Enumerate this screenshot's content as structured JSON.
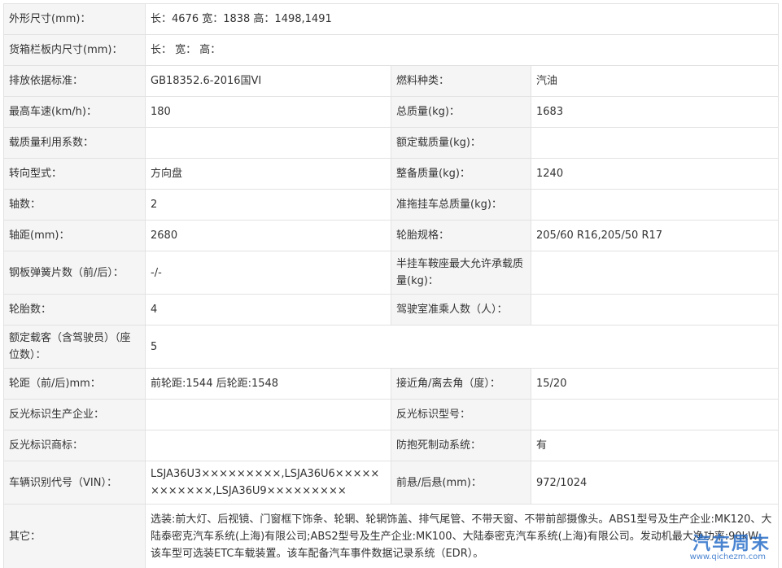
{
  "rows": [
    {
      "l1": "外形尺寸(mm)：",
      "v1": "长：4676 宽：1838 高：1498,1491"
    },
    {
      "l1": "货箱栏板内尺寸(mm)：",
      "v1": "长： 宽： 高："
    },
    {
      "l1": "排放依据标准：",
      "v1": "GB18352.6-2016国VI",
      "l2": "燃料种类：",
      "v2": "汽油"
    },
    {
      "l1": "最高车速(km/h)：",
      "v1": "180",
      "l2": "总质量(kg)：",
      "v2": "1683"
    },
    {
      "l1": "载质量利用系数：",
      "v1": "",
      "l2": "额定载质量(kg)：",
      "v2": ""
    },
    {
      "l1": "转向型式：",
      "v1": "方向盘",
      "l2": "整备质量(kg)：",
      "v2": "1240"
    },
    {
      "l1": "轴数：",
      "v1": "2",
      "l2": "准拖挂车总质量(kg)：",
      "v2": ""
    },
    {
      "l1": "轴距(mm)：",
      "v1": "2680",
      "l2": "轮胎规格：",
      "v2": "205/60 R16,205/50 R17"
    },
    {
      "l1": "钢板弹簧片数（前/后）：",
      "v1": "-/-",
      "l2": "半挂车鞍座最大允许承载质量(kg)：",
      "v2": ""
    },
    {
      "l1": "轮胎数：",
      "v1": "4",
      "l2": "驾驶室准乘人数（人）：",
      "v2": ""
    },
    {
      "l1": "额定载客（含驾驶员）（座位数）：",
      "v1": "5"
    },
    {
      "l1": "轮距（前/后)mm：",
      "v1": "前轮距:1544 后轮距:1548",
      "l2": "接近角/离去角（度）：",
      "v2": "15/20"
    },
    {
      "l1": "反光标识生产企业：",
      "v1": "",
      "l2": "反光标识型号：",
      "v2": ""
    },
    {
      "l1": "反光标识商标：",
      "v1": "",
      "l2": "防抱死制动系统：",
      "v2": "有"
    },
    {
      "l1": "车辆识别代号（VIN）：",
      "v1": "LSJA36U3×××××××××,LSJA36U6××××××××××××,LSJA36U9×××××××××",
      "l2": "前悬/后悬(mm)：",
      "v2": "972/1024"
    },
    {
      "l1": "其它：",
      "v1": "选装:前大灯、后视镜、门窗框下饰条、轮辋、轮辋饰盖、排气尾管、不带天窗、不带前部摄像头。ABS1型号及生产企业:MK120、大陆泰密克汽车系统(上海)有限公司;ABS2型号及生产企业:MK100、大陆泰密克汽车系统(上海)有限公司。发动机最大净功率:90kW。该车型可选装ETC车载装置。该车配备汽车事件数据记录系统（EDR）。"
    }
  ],
  "watermark": {
    "title": "汽车周末",
    "url": "www.qichezm.com"
  }
}
